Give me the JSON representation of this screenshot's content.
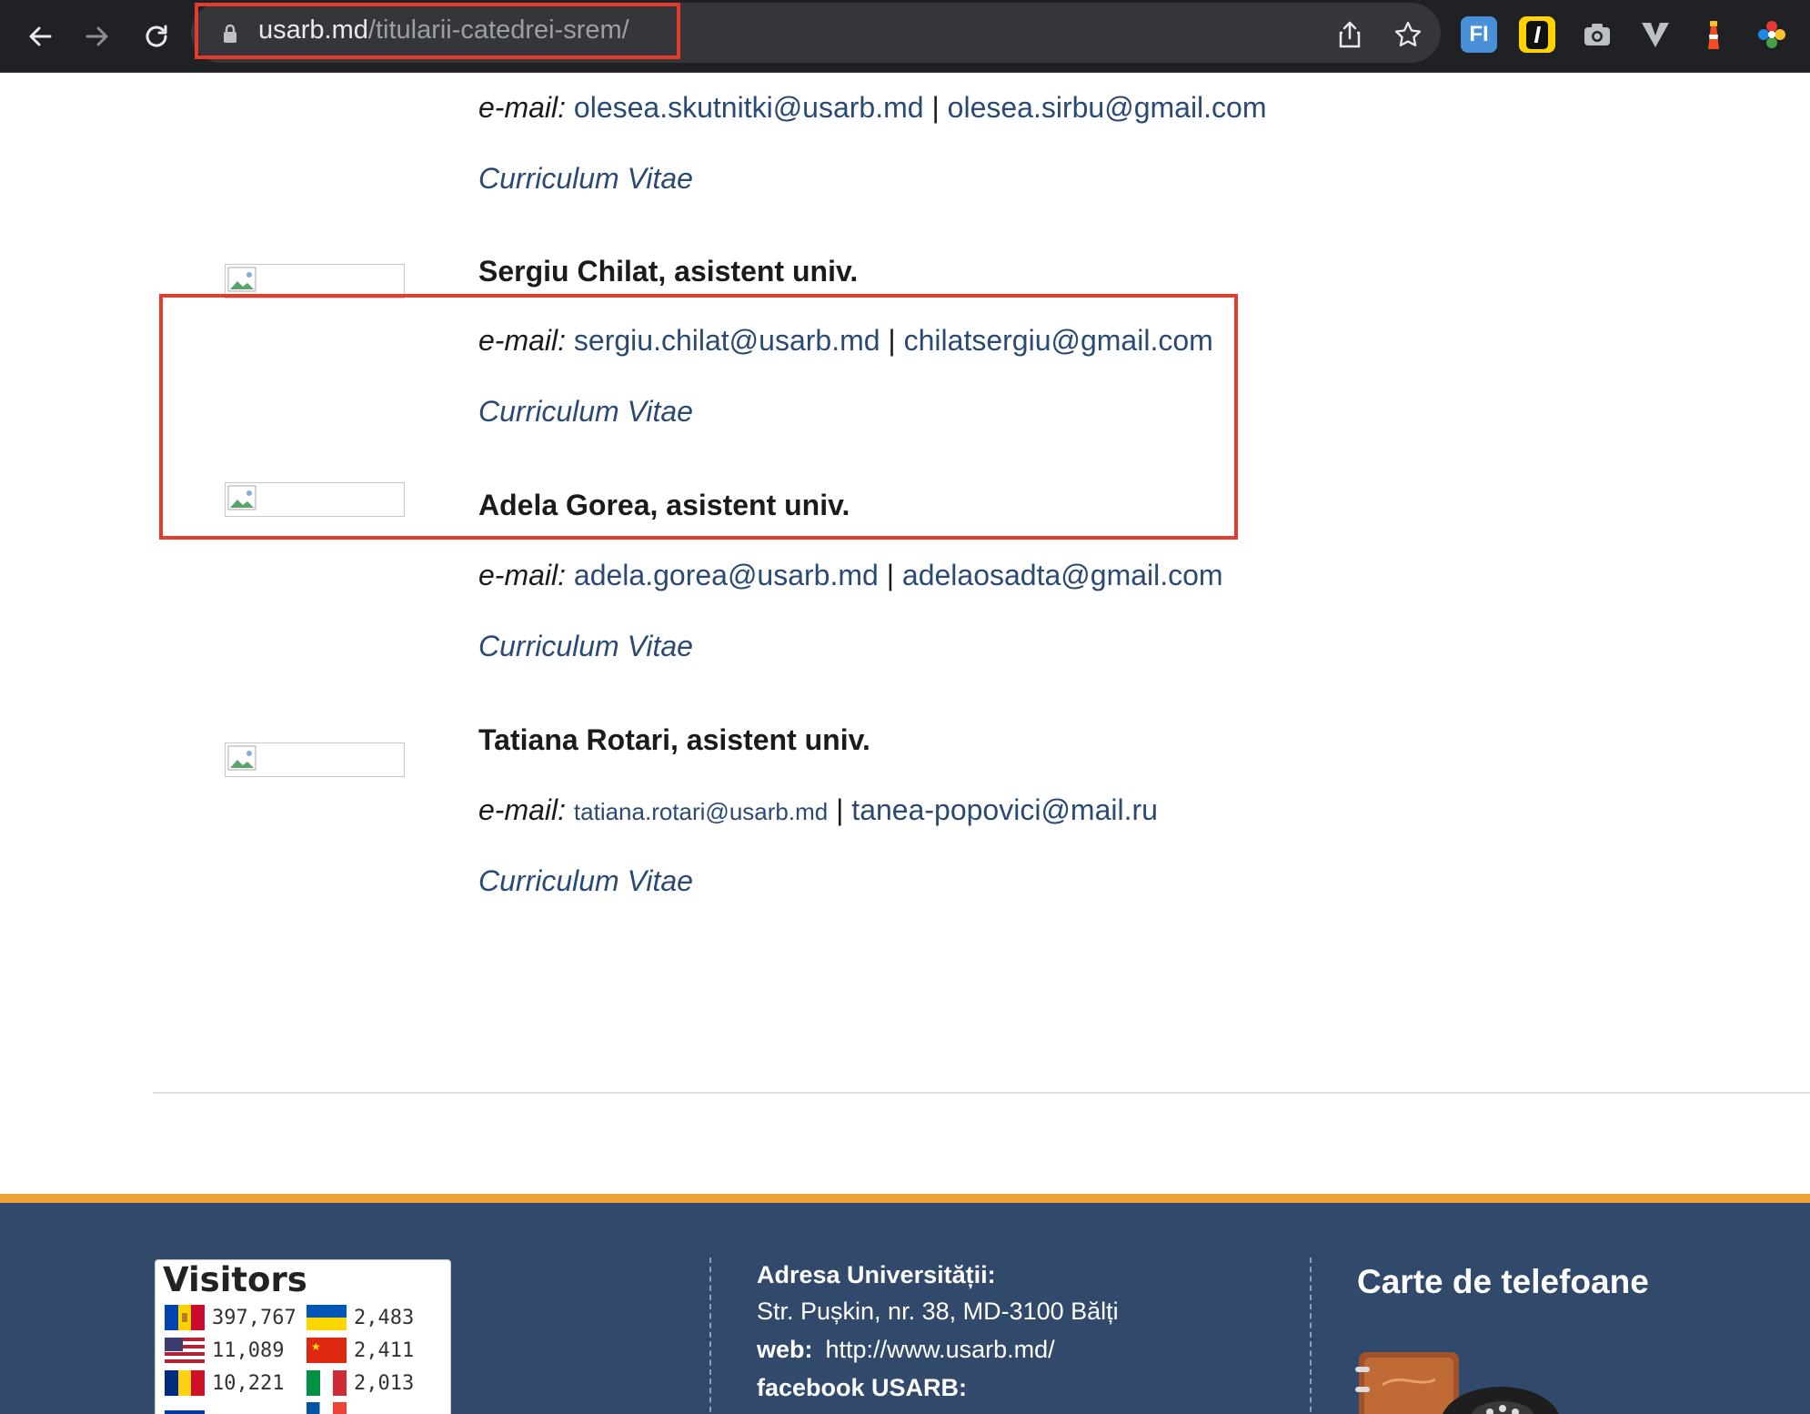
{
  "browser": {
    "url_host": "usarb.md",
    "url_path": "/titularii-catedrei-srem/",
    "extensions": [
      "fi-extension-icon",
      "i-extension-icon",
      "camera-extension-icon",
      "v-extension-icon",
      "lighthouse-extension-icon",
      "color-picker-extension-icon"
    ]
  },
  "prev_entry": {
    "email_label": "e-mail:",
    "email_1": "olesea.skutnitki@usarb.md",
    "separator": "|",
    "email_2": "olesea.sirbu@gmail.com",
    "cv": "Curriculum Vitae"
  },
  "people": [
    {
      "name": "Sergiu Chilat, asistent univ.",
      "email_label": "e-mail:",
      "email_1": "sergiu.chilat@usarb.md",
      "separator": "|",
      "email_2": "chilatsergiu@gmail.com",
      "cv": "Curriculum Vitae"
    },
    {
      "name": "Adela Gorea, asistent univ.",
      "email_label": "e-mail:",
      "email_1": "adela.gorea@usarb.md",
      "separator": "|",
      "email_2": "adelaosadta@gmail.com",
      "cv": "Curriculum Vitae"
    },
    {
      "name": "Tatiana Rotari, asistent univ.",
      "email_label": "e-mail:",
      "email_1": "tatiana.rotari@usarb.md",
      "separator": "|",
      "email_2": "tanea-popovici@mail.ru",
      "cv": "Curriculum Vitae"
    }
  ],
  "footer": {
    "visitors": {
      "title": "Visitors",
      "rows": [
        {
          "country": "Moldova",
          "count": "397,767"
        },
        {
          "country": "Ukraine",
          "count": "2,483"
        },
        {
          "country": "United States",
          "count": "11,089"
        },
        {
          "country": "China",
          "count": "2,411"
        },
        {
          "country": "Romania",
          "count": "10,221"
        },
        {
          "country": "Italy",
          "count": "2,013"
        }
      ]
    },
    "address_title": "Adresa Universității:",
    "address_line": "Str. Pușkin, nr. 38, MD-3100 Bălți",
    "web_label": "web:",
    "web_url": "http://www.usarb.md/",
    "facebook": "facebook USARB:",
    "phones_title": "Carte de telefoane"
  },
  "colors": {
    "link": "#2b4a73",
    "highlight": "#e53b2c",
    "footer_bg": "#31496b",
    "footer_accent": "#eea33b"
  }
}
